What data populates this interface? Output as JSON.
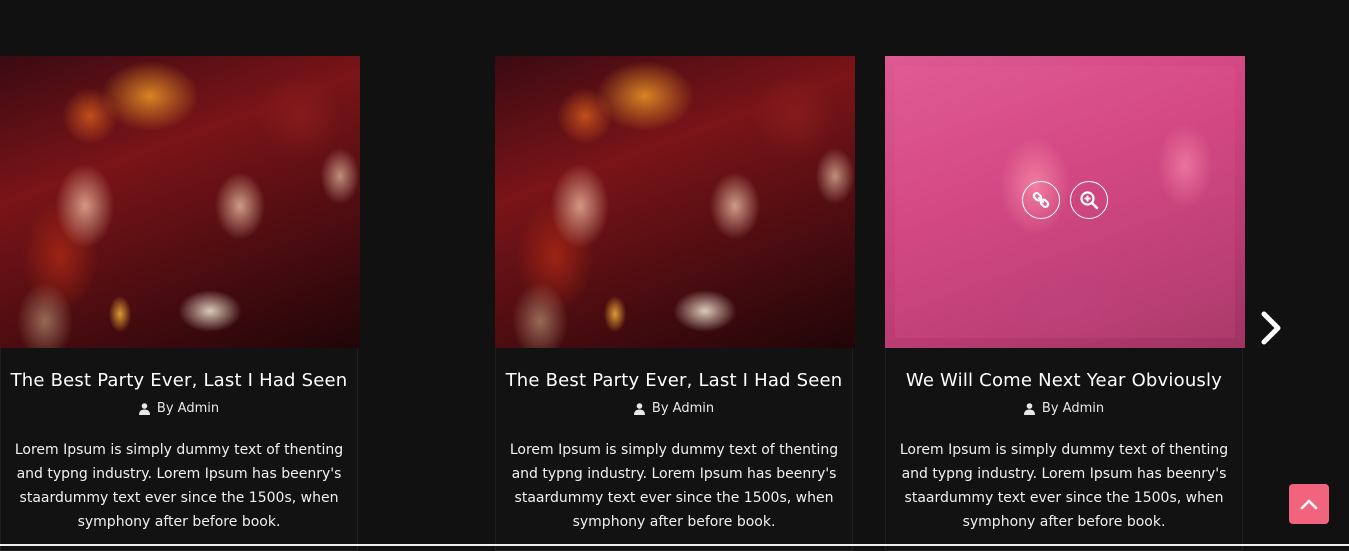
{
  "carousel": {
    "prev_icon": "chevron-left-icon",
    "next_icon": "chevron-right-icon",
    "cards": [
      {
        "title": "The Best Party Ever, Last I Had Seen",
        "author": "By Admin",
        "excerpt": "Lorem Ipsum is simply dummy text of thenting and typng industry. Lorem Ipsum has beenry's staardummy text ever since the 1500s, when symphony after before book."
      },
      {
        "title": "We Will Come Next Year Obviously",
        "author": "By Admin",
        "excerpt": "Lorem Ipsum is simply dummy text of thenting and typng industry. Lorem Ipsum has beenry's staardummy text ever since the 1500s, when symphony after before book.",
        "hover_icons": [
          "link-icon",
          "zoom-in-icon"
        ]
      },
      {
        "title": "The Best Party Ever, Last I Had Seen",
        "author": "By Admin",
        "excerpt": "Lorem Ipsum is simply dummy text of thenting and typng industry. Lorem Ipsum has beenry's staardummy text ever since the 1500s, when symphony after before book."
      }
    ]
  },
  "scroll_top": {
    "icon": "chevron-up-icon"
  },
  "colors": {
    "background": "#111111",
    "accent": "#f2647d",
    "overlay": "#ff5a96"
  }
}
